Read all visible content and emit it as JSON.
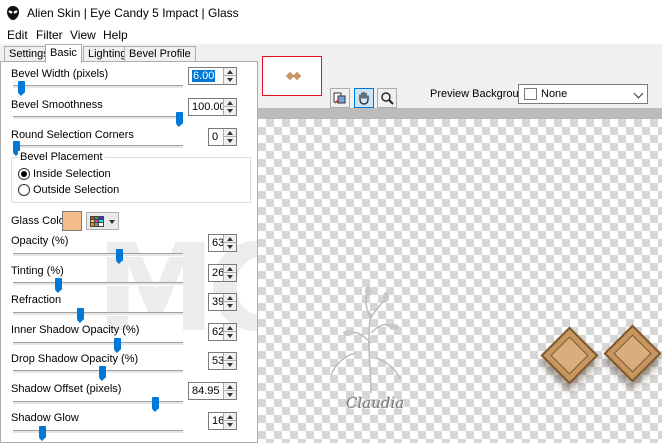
{
  "window": {
    "title": "Alien Skin | Eye Candy 5 Impact | Glass"
  },
  "menu": [
    "Edit",
    "Filter",
    "View",
    "Help"
  ],
  "tabs": [
    {
      "label": "Settings",
      "active": false
    },
    {
      "label": "Basic",
      "active": true
    },
    {
      "label": "Lighting",
      "active": false
    },
    {
      "label": "Bevel Profile",
      "active": false
    }
  ],
  "controls": {
    "bevel_width": {
      "label": "Bevel Width (pixels)",
      "value": "6.00",
      "level": 0.03
    },
    "bevel_smoothness": {
      "label": "Bevel Smoothness",
      "value": "100.00",
      "level": 1.0
    },
    "round_corners": {
      "label": "Round Selection Corners",
      "value": "0",
      "level": 0.0
    },
    "opacity": {
      "label": "Opacity (%)",
      "value": "63",
      "level": 0.63
    },
    "tinting": {
      "label": "Tinting (%)",
      "value": "26",
      "level": 0.26
    },
    "refraction": {
      "label": "Refraction",
      "value": "39",
      "level": 0.39
    },
    "inner_shadow": {
      "label": "Inner Shadow Opacity (%)",
      "value": "62",
      "level": 0.62
    },
    "drop_shadow": {
      "label": "Drop Shadow Opacity (%)",
      "value": "53",
      "level": 0.53
    },
    "shadow_offset": {
      "label": "Shadow Offset (pixels)",
      "value": "84.95",
      "level": 0.85
    },
    "shadow_glow": {
      "label": "Shadow Glow",
      "value": "16",
      "level": 0.16
    }
  },
  "bevel_placement": {
    "legend": "Bevel Placement",
    "options": [
      {
        "label": "Inside Selection",
        "selected": true
      },
      {
        "label": "Outside Selection",
        "selected": false
      }
    ]
  },
  "glass_color": {
    "label": "Glass Color",
    "color": "#f4be8c"
  },
  "preview": {
    "background_label": "Preview Background:",
    "background_value": "None",
    "tools": [
      "bevel-preview-icon",
      "hand-icon",
      "zoom-icon"
    ],
    "watermark_text": "Claudia"
  },
  "colors": {
    "accent": "#0078d7",
    "nav_frame": "#e81123",
    "gem_fill": "#c8965e"
  }
}
